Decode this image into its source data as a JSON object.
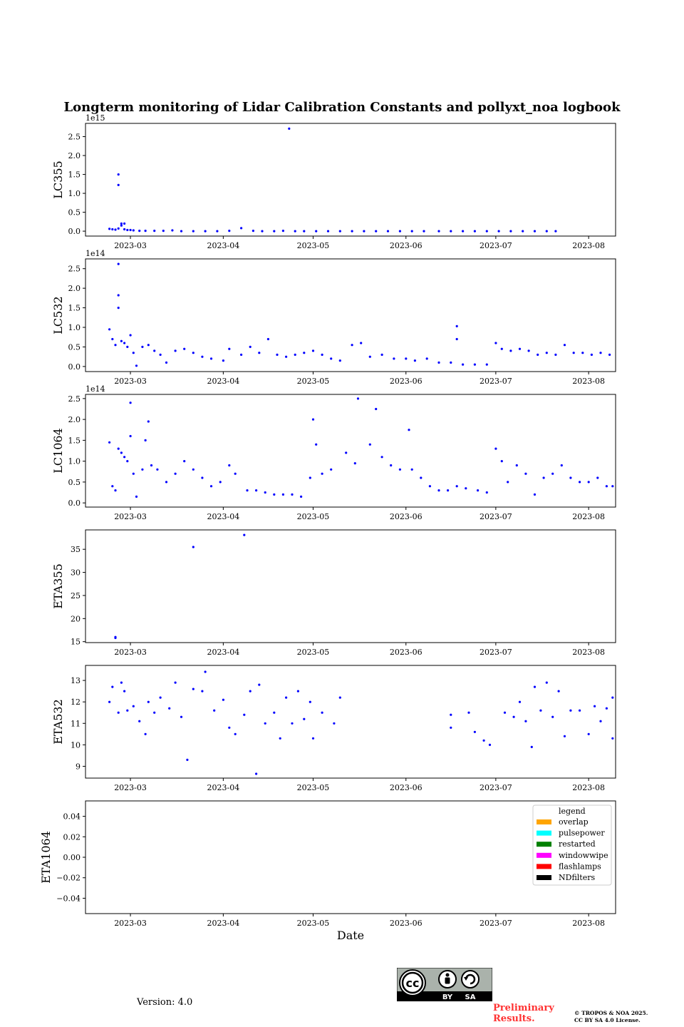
{
  "title": "Longterm monitoring of Lidar Calibration Constants and pollyxt_noa logbook",
  "xlabel": "Date",
  "version_text": "Version: 4.0",
  "preliminary_text": [
    "Preliminary",
    "Results."
  ],
  "copyright_text": [
    "© TROPOS & NOA 2025.",
    "CC BY SA 4.0 License."
  ],
  "license_badge": {
    "labels": [
      "BY",
      "SA"
    ],
    "icons": [
      "cc-icon",
      "by-person-icon",
      "sa-icon"
    ]
  },
  "colors": {
    "points": "#0000ff"
  },
  "chart_data": [
    {
      "type": "scatter",
      "name": "LC355",
      "ylabel": "LC355",
      "offset_text": "1e15",
      "x_ticks": [
        "2023-03",
        "2023-04",
        "2023-05",
        "2023-06",
        "2023-07",
        "2023-08"
      ],
      "y_ticks": [
        "0.0",
        "0.5",
        "1.0",
        "1.5",
        "2.0",
        "2.5"
      ],
      "ylim": [
        -0.13,
        2.85
      ],
      "xlim": [
        "2023-02-14",
        "2023-08-10"
      ],
      "points": [
        [
          "2023-02-22",
          0.06
        ],
        [
          "2023-02-23",
          0.05
        ],
        [
          "2023-02-24",
          0.04
        ],
        [
          "2023-02-25",
          0.07
        ],
        [
          "2023-02-25",
          1.5
        ],
        [
          "2023-02-25",
          1.22
        ],
        [
          "2023-02-26",
          0.15
        ],
        [
          "2023-02-26",
          0.2
        ],
        [
          "2023-02-27",
          0.2
        ],
        [
          "2023-02-27",
          0.05
        ],
        [
          "2023-02-28",
          0.03
        ],
        [
          "2023-03-01",
          0.03
        ],
        [
          "2023-03-02",
          0.02
        ],
        [
          "2023-03-04",
          0.01
        ],
        [
          "2023-03-06",
          0.01
        ],
        [
          "2023-03-09",
          0.01
        ],
        [
          "2023-03-12",
          0.01
        ],
        [
          "2023-03-15",
          0.02
        ],
        [
          "2023-03-18",
          0.0
        ],
        [
          "2023-03-22",
          0.0
        ],
        [
          "2023-03-26",
          0.0
        ],
        [
          "2023-03-30",
          0.0
        ],
        [
          "2023-04-03",
          0.01
        ],
        [
          "2023-04-07",
          0.08
        ],
        [
          "2023-04-11",
          0.01
        ],
        [
          "2023-04-14",
          0.0
        ],
        [
          "2023-04-18",
          0.0
        ],
        [
          "2023-04-21",
          0.01
        ],
        [
          "2023-04-23",
          2.71
        ],
        [
          "2023-04-25",
          0.0
        ],
        [
          "2023-04-28",
          0.0
        ],
        [
          "2023-05-02",
          0.0
        ],
        [
          "2023-05-06",
          0.0
        ],
        [
          "2023-05-10",
          0.0
        ],
        [
          "2023-05-14",
          0.0
        ],
        [
          "2023-05-18",
          0.0
        ],
        [
          "2023-05-22",
          0.0
        ],
        [
          "2023-05-26",
          0.0
        ],
        [
          "2023-05-30",
          0.0
        ],
        [
          "2023-06-03",
          0.0
        ],
        [
          "2023-06-07",
          0.0
        ],
        [
          "2023-06-12",
          0.0
        ],
        [
          "2023-06-16",
          0.0
        ],
        [
          "2023-06-20",
          0.0
        ],
        [
          "2023-06-24",
          0.0
        ],
        [
          "2023-06-28",
          0.0
        ],
        [
          "2023-07-02",
          0.0
        ],
        [
          "2023-07-06",
          0.0
        ],
        [
          "2023-07-10",
          0.0
        ],
        [
          "2023-07-14",
          0.0
        ],
        [
          "2023-07-18",
          0.0
        ],
        [
          "2023-07-21",
          0.0
        ]
      ]
    },
    {
      "type": "scatter",
      "name": "LC532",
      "ylabel": "LC532",
      "offset_text": "1e14",
      "x_ticks": [
        "2023-03",
        "2023-04",
        "2023-05",
        "2023-06",
        "2023-07",
        "2023-08"
      ],
      "y_ticks": [
        "0.0",
        "0.5",
        "1.0",
        "1.5",
        "2.0",
        "2.5"
      ],
      "ylim": [
        -0.13,
        2.75
      ],
      "xlim": [
        "2023-02-14",
        "2023-08-10"
      ],
      "points": [
        [
          "2023-02-22",
          0.95
        ],
        [
          "2023-02-23",
          0.7
        ],
        [
          "2023-02-24",
          0.55
        ],
        [
          "2023-02-25",
          1.82
        ],
        [
          "2023-02-25",
          1.5
        ],
        [
          "2023-02-25",
          2.62
        ],
        [
          "2023-02-26",
          0.65
        ],
        [
          "2023-02-27",
          0.6
        ],
        [
          "2023-02-28",
          0.5
        ],
        [
          "2023-03-01",
          0.8
        ],
        [
          "2023-03-02",
          0.35
        ],
        [
          "2023-03-03",
          0.02
        ],
        [
          "2023-03-05",
          0.5
        ],
        [
          "2023-03-07",
          0.55
        ],
        [
          "2023-03-09",
          0.4
        ],
        [
          "2023-03-11",
          0.3
        ],
        [
          "2023-03-13",
          0.1
        ],
        [
          "2023-03-16",
          0.4
        ],
        [
          "2023-03-19",
          0.45
        ],
        [
          "2023-03-22",
          0.35
        ],
        [
          "2023-03-25",
          0.25
        ],
        [
          "2023-03-28",
          0.2
        ],
        [
          "2023-04-01",
          0.15
        ],
        [
          "2023-04-03",
          0.45
        ],
        [
          "2023-04-07",
          0.3
        ],
        [
          "2023-04-10",
          0.5
        ],
        [
          "2023-04-13",
          0.35
        ],
        [
          "2023-04-16",
          0.7
        ],
        [
          "2023-04-19",
          0.3
        ],
        [
          "2023-04-22",
          0.25
        ],
        [
          "2023-04-25",
          0.3
        ],
        [
          "2023-04-28",
          0.35
        ],
        [
          "2023-05-01",
          0.4
        ],
        [
          "2023-05-04",
          0.3
        ],
        [
          "2023-05-07",
          0.2
        ],
        [
          "2023-05-10",
          0.15
        ],
        [
          "2023-05-14",
          0.55
        ],
        [
          "2023-05-17",
          0.6
        ],
        [
          "2023-05-20",
          0.25
        ],
        [
          "2023-05-24",
          0.3
        ],
        [
          "2023-05-28",
          0.2
        ],
        [
          "2023-06-01",
          0.2
        ],
        [
          "2023-06-04",
          0.15
        ],
        [
          "2023-06-08",
          0.2
        ],
        [
          "2023-06-12",
          0.1
        ],
        [
          "2023-06-16",
          0.1
        ],
        [
          "2023-06-18",
          1.03
        ],
        [
          "2023-06-18",
          0.7
        ],
        [
          "2023-06-20",
          0.05
        ],
        [
          "2023-06-24",
          0.05
        ],
        [
          "2023-06-28",
          0.05
        ],
        [
          "2023-07-01",
          0.6
        ],
        [
          "2023-07-03",
          0.45
        ],
        [
          "2023-07-06",
          0.4
        ],
        [
          "2023-07-09",
          0.45
        ],
        [
          "2023-07-12",
          0.4
        ],
        [
          "2023-07-15",
          0.3
        ],
        [
          "2023-07-18",
          0.35
        ],
        [
          "2023-07-21",
          0.3
        ],
        [
          "2023-07-24",
          0.55
        ],
        [
          "2023-07-27",
          0.35
        ],
        [
          "2023-07-30",
          0.35
        ],
        [
          "2023-08-02",
          0.3
        ],
        [
          "2023-08-05",
          0.35
        ],
        [
          "2023-08-08",
          0.3
        ]
      ]
    },
    {
      "type": "scatter",
      "name": "LC1064",
      "ylabel": "LC1064",
      "offset_text": "1e14",
      "x_ticks": [
        "2023-03",
        "2023-04",
        "2023-05",
        "2023-06",
        "2023-07",
        "2023-08"
      ],
      "y_ticks": [
        "0.0",
        "0.5",
        "1.0",
        "1.5",
        "2.0",
        "2.5"
      ],
      "ylim": [
        -0.1,
        2.6
      ],
      "xlim": [
        "2023-02-14",
        "2023-08-10"
      ],
      "points": [
        [
          "2023-02-22",
          1.45
        ],
        [
          "2023-02-23",
          0.4
        ],
        [
          "2023-02-24",
          0.3
        ],
        [
          "2023-02-25",
          1.3
        ],
        [
          "2023-02-26",
          1.2
        ],
        [
          "2023-02-27",
          1.1
        ],
        [
          "2023-02-28",
          1.0
        ],
        [
          "2023-03-01",
          1.6
        ],
        [
          "2023-03-01",
          2.4
        ],
        [
          "2023-03-02",
          0.7
        ],
        [
          "2023-03-03",
          0.15
        ],
        [
          "2023-03-05",
          0.8
        ],
        [
          "2023-03-06",
          1.5
        ],
        [
          "2023-03-07",
          1.95
        ],
        [
          "2023-03-08",
          0.9
        ],
        [
          "2023-03-10",
          0.8
        ],
        [
          "2023-03-13",
          0.5
        ],
        [
          "2023-03-16",
          0.7
        ],
        [
          "2023-03-19",
          1.0
        ],
        [
          "2023-03-22",
          0.8
        ],
        [
          "2023-03-25",
          0.6
        ],
        [
          "2023-03-28",
          0.4
        ],
        [
          "2023-03-31",
          0.5
        ],
        [
          "2023-04-03",
          0.9
        ],
        [
          "2023-04-05",
          0.7
        ],
        [
          "2023-04-09",
          0.3
        ],
        [
          "2023-04-12",
          0.3
        ],
        [
          "2023-04-15",
          0.25
        ],
        [
          "2023-04-18",
          0.2
        ],
        [
          "2023-04-21",
          0.2
        ],
        [
          "2023-04-24",
          0.2
        ],
        [
          "2023-04-27",
          0.15
        ],
        [
          "2023-04-30",
          0.6
        ],
        [
          "2023-05-01",
          2.0
        ],
        [
          "2023-05-02",
          1.4
        ],
        [
          "2023-05-04",
          0.7
        ],
        [
          "2023-05-07",
          0.8
        ],
        [
          "2023-05-12",
          1.2
        ],
        [
          "2023-05-15",
          0.95
        ],
        [
          "2023-05-16",
          2.5
        ],
        [
          "2023-05-20",
          1.4
        ],
        [
          "2023-05-22",
          2.25
        ],
        [
          "2023-05-24",
          1.1
        ],
        [
          "2023-05-27",
          0.9
        ],
        [
          "2023-05-30",
          0.8
        ],
        [
          "2023-06-02",
          1.75
        ],
        [
          "2023-06-03",
          0.8
        ],
        [
          "2023-06-06",
          0.6
        ],
        [
          "2023-06-09",
          0.4
        ],
        [
          "2023-06-12",
          0.3
        ],
        [
          "2023-06-15",
          0.3
        ],
        [
          "2023-06-18",
          0.4
        ],
        [
          "2023-06-21",
          0.35
        ],
        [
          "2023-06-25",
          0.3
        ],
        [
          "2023-06-28",
          0.25
        ],
        [
          "2023-07-01",
          1.3
        ],
        [
          "2023-07-03",
          1.0
        ],
        [
          "2023-07-05",
          0.5
        ],
        [
          "2023-07-08",
          0.9
        ],
        [
          "2023-07-11",
          0.7
        ],
        [
          "2023-07-14",
          0.2
        ],
        [
          "2023-07-17",
          0.6
        ],
        [
          "2023-07-20",
          0.7
        ],
        [
          "2023-07-23",
          0.9
        ],
        [
          "2023-07-26",
          0.6
        ],
        [
          "2023-07-29",
          0.5
        ],
        [
          "2023-08-01",
          0.5
        ],
        [
          "2023-08-04",
          0.6
        ],
        [
          "2023-08-07",
          0.4
        ],
        [
          "2023-08-09",
          0.4
        ]
      ]
    },
    {
      "type": "scatter",
      "name": "ETA355",
      "ylabel": "ETA355",
      "offset_text": "",
      "x_ticks": [
        "2023-03",
        "2023-04",
        "2023-05",
        "2023-06",
        "2023-07",
        "2023-08"
      ],
      "y_ticks": [
        "15",
        "20",
        "25",
        "30",
        "35"
      ],
      "ylim": [
        14.8,
        39.2
      ],
      "xlim": [
        "2023-02-14",
        "2023-08-10"
      ],
      "points": [
        [
          "2023-02-24",
          15.8
        ],
        [
          "2023-02-24",
          16.0
        ],
        [
          "2023-03-22",
          35.5
        ],
        [
          "2023-04-08",
          38.1
        ]
      ]
    },
    {
      "type": "scatter",
      "name": "ETA532",
      "ylabel": "ETA532",
      "offset_text": "",
      "x_ticks": [
        "2023-03",
        "2023-04",
        "2023-05",
        "2023-06",
        "2023-07",
        "2023-08"
      ],
      "y_ticks": [
        "9",
        "10",
        "11",
        "12",
        "13"
      ],
      "ylim": [
        8.45,
        13.7
      ],
      "xlim": [
        "2023-02-14",
        "2023-08-10"
      ],
      "points": [
        [
          "2023-02-22",
          12.0
        ],
        [
          "2023-02-23",
          12.7
        ],
        [
          "2023-02-25",
          11.5
        ],
        [
          "2023-02-26",
          12.9
        ],
        [
          "2023-02-27",
          12.5
        ],
        [
          "2023-02-28",
          11.6
        ],
        [
          "2023-03-02",
          11.8
        ],
        [
          "2023-03-04",
          11.1
        ],
        [
          "2023-03-06",
          10.5
        ],
        [
          "2023-03-07",
          12.0
        ],
        [
          "2023-03-09",
          11.5
        ],
        [
          "2023-03-11",
          12.2
        ],
        [
          "2023-03-14",
          11.7
        ],
        [
          "2023-03-16",
          12.9
        ],
        [
          "2023-03-18",
          11.3
        ],
        [
          "2023-03-20",
          9.3
        ],
        [
          "2023-03-22",
          12.6
        ],
        [
          "2023-03-25",
          12.5
        ],
        [
          "2023-03-26",
          13.4
        ],
        [
          "2023-03-29",
          11.6
        ],
        [
          "2023-04-01",
          12.1
        ],
        [
          "2023-04-03",
          10.8
        ],
        [
          "2023-04-05",
          10.5
        ],
        [
          "2023-04-08",
          11.4
        ],
        [
          "2023-04-10",
          12.5
        ],
        [
          "2023-04-12",
          8.65
        ],
        [
          "2023-04-13",
          12.8
        ],
        [
          "2023-04-15",
          11.0
        ],
        [
          "2023-04-18",
          11.5
        ],
        [
          "2023-04-20",
          10.3
        ],
        [
          "2023-04-22",
          12.2
        ],
        [
          "2023-04-24",
          11.0
        ],
        [
          "2023-04-26",
          12.5
        ],
        [
          "2023-04-28",
          11.2
        ],
        [
          "2023-04-30",
          12.0
        ],
        [
          "2023-05-01",
          10.3
        ],
        [
          "2023-05-04",
          11.5
        ],
        [
          "2023-05-08",
          11.0
        ],
        [
          "2023-05-10",
          12.2
        ],
        [
          "2023-06-16",
          11.4
        ],
        [
          "2023-06-16",
          10.8
        ],
        [
          "2023-06-22",
          11.5
        ],
        [
          "2023-06-24",
          10.6
        ],
        [
          "2023-06-27",
          10.2
        ],
        [
          "2023-06-29",
          10.0
        ],
        [
          "2023-07-04",
          11.5
        ],
        [
          "2023-07-07",
          11.3
        ],
        [
          "2023-07-09",
          12.0
        ],
        [
          "2023-07-11",
          11.1
        ],
        [
          "2023-07-13",
          9.9
        ],
        [
          "2023-07-14",
          12.7
        ],
        [
          "2023-07-16",
          11.6
        ],
        [
          "2023-07-18",
          12.9
        ],
        [
          "2023-07-20",
          11.3
        ],
        [
          "2023-07-22",
          12.5
        ],
        [
          "2023-07-24",
          10.4
        ],
        [
          "2023-07-26",
          11.6
        ],
        [
          "2023-07-29",
          11.6
        ],
        [
          "2023-08-01",
          10.5
        ],
        [
          "2023-08-03",
          11.8
        ],
        [
          "2023-08-05",
          11.1
        ],
        [
          "2023-08-07",
          11.7
        ],
        [
          "2023-08-09",
          12.2
        ],
        [
          "2023-08-09",
          10.3
        ]
      ]
    },
    {
      "type": "scatter",
      "name": "ETA1064",
      "ylabel": "ETA1064",
      "offset_text": "",
      "x_ticks": [
        "2023-03",
        "2023-04",
        "2023-05",
        "2023-06",
        "2023-07",
        "2023-08"
      ],
      "y_ticks": [
        "−0.04",
        "−0.02",
        "0.00",
        "0.02",
        "0.04"
      ],
      "ylim": [
        -0.055,
        0.055
      ],
      "xlim": [
        "2023-02-14",
        "2023-08-10"
      ],
      "points": [],
      "legend": {
        "title": "legend",
        "position": "upper right",
        "entries": [
          {
            "label": "overlap",
            "color": "#ffa500"
          },
          {
            "label": "pulsepower",
            "color": "#00ffff"
          },
          {
            "label": "restarted",
            "color": "#008000"
          },
          {
            "label": "windowwipe",
            "color": "#ff00ff"
          },
          {
            "label": "flashlamps",
            "color": "#ff0000"
          },
          {
            "label": "NDfilters",
            "color": "#000000"
          }
        ]
      }
    }
  ]
}
